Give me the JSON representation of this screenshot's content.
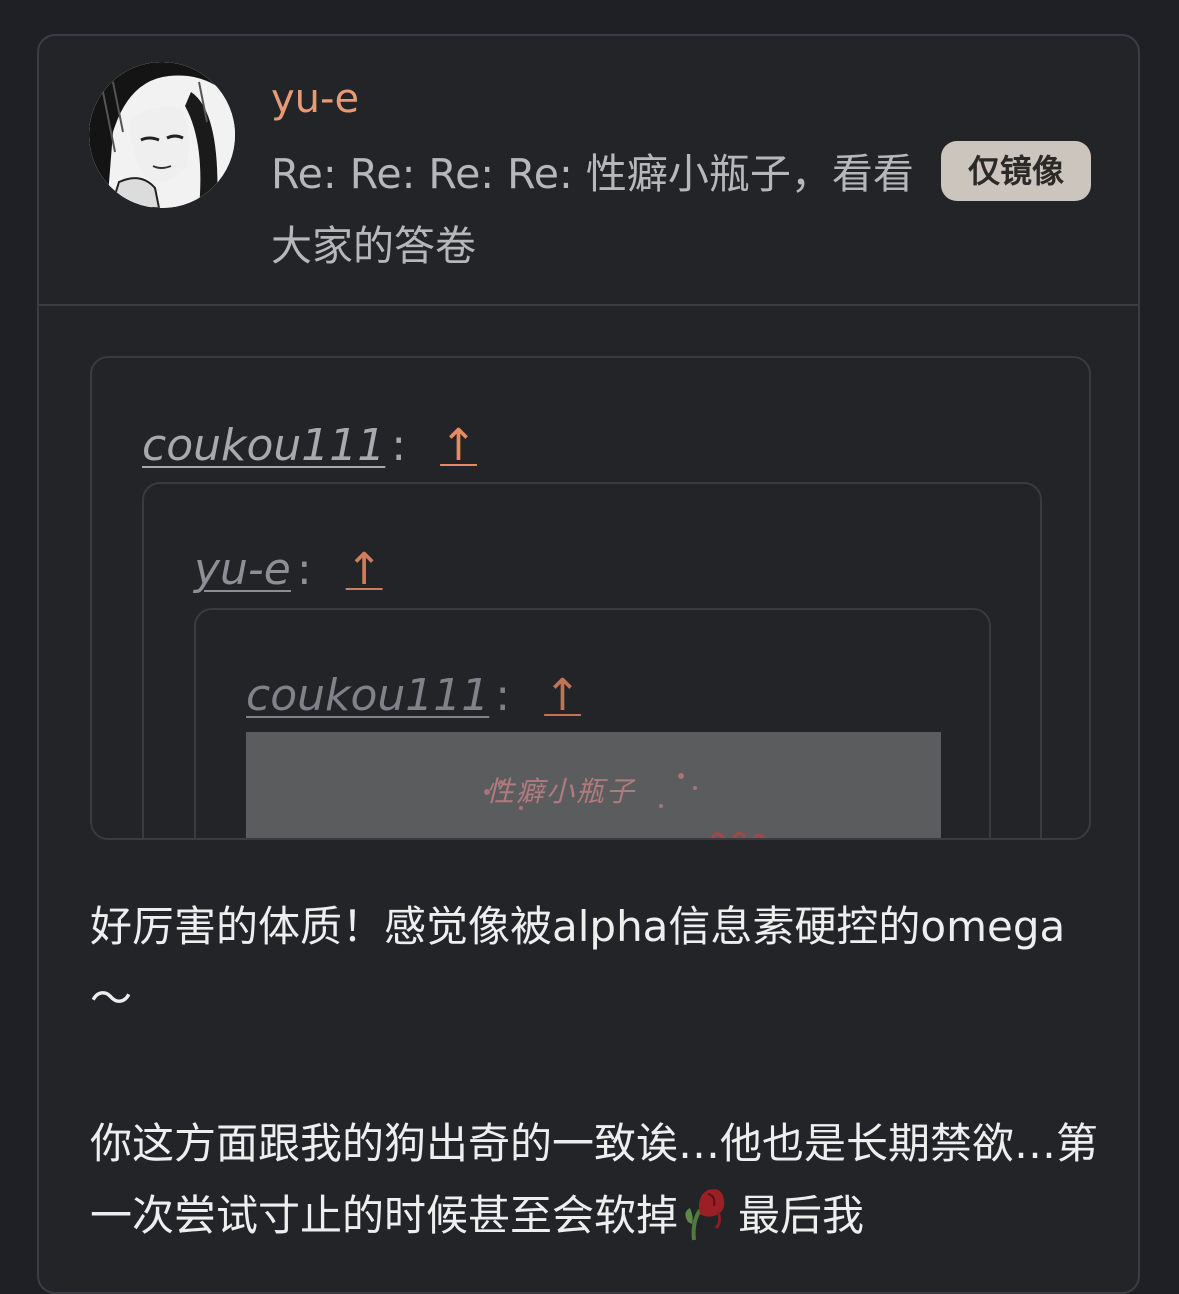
{
  "post": {
    "username": "yu-e",
    "title": "Re: Re: Re: Re: 性癖小瓶子，看看大家的答卷",
    "badge": "仅镜像"
  },
  "quotes": {
    "level1": {
      "author": "coukou111",
      "colon": ":",
      "up": "↑"
    },
    "level2": {
      "author": "yu-e",
      "colon": ":",
      "up": "↑"
    },
    "level3": {
      "author": "coukou111",
      "colon": ":",
      "up": "↑",
      "image_text": "性癖小瓶子"
    }
  },
  "content": {
    "p1": "好厉害的体质！感觉像被alpha信息素硬控的omega～",
    "p2_before": "你这方面跟我的狗出奇的一致诶…他也是长期禁欲…第一次尝试寸止的时候甚至会软掉",
    "p2_emoji": "wilted-rose-emoji",
    "p2_after": "最后我"
  },
  "colors": {
    "background": "#1e2025",
    "card": "#222428",
    "username": "#e99a75",
    "up_arrow": "#e8895f",
    "badge_bg": "#ccc5bd"
  }
}
